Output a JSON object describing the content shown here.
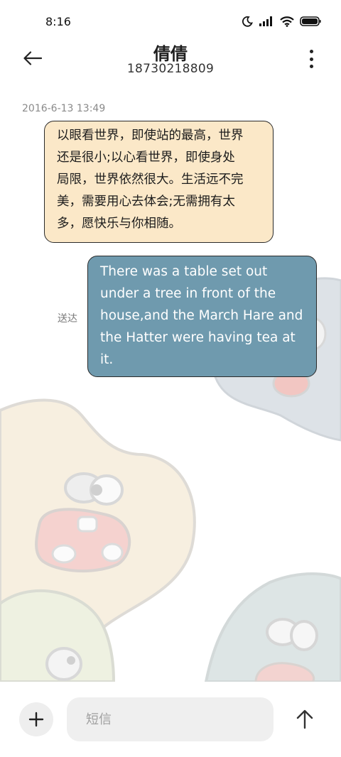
{
  "status_bar": {
    "time": "8:16",
    "icons": [
      "moon-icon",
      "signal-icon",
      "wifi-icon",
      "battery-icon"
    ]
  },
  "header": {
    "contact_name": "倩倩",
    "contact_number": "18730218809",
    "back_icon": "arrow-left-icon",
    "menu_icon": "more-vertical-icon"
  },
  "conversation": {
    "timestamp": "2016-6-13 13:49",
    "incoming": {
      "lines": [
        "以眼看世界，即使站的最高，世界",
        "还是很小;以心看世界，即使身处",
        "局限，世界依然很大。生活远不完",
        "美，需要用心去体会;无需拥有太",
        "多，愿快乐与你相随。"
      ]
    },
    "outgoing": {
      "lines": [
        "There was a table set out",
        "under a tree in front of the",
        "house,and the March Hare and",
        "the Hatter were having tea at",
        "it."
      ],
      "status": "送达"
    }
  },
  "composer": {
    "placeholder": "短信",
    "add_icon": "plus-icon",
    "send_icon": "arrow-up-icon"
  },
  "colors": {
    "incoming_bubble": "#fbe8c8",
    "outgoing_bubble": "#6f9aae",
    "input_bg": "#efefef"
  }
}
